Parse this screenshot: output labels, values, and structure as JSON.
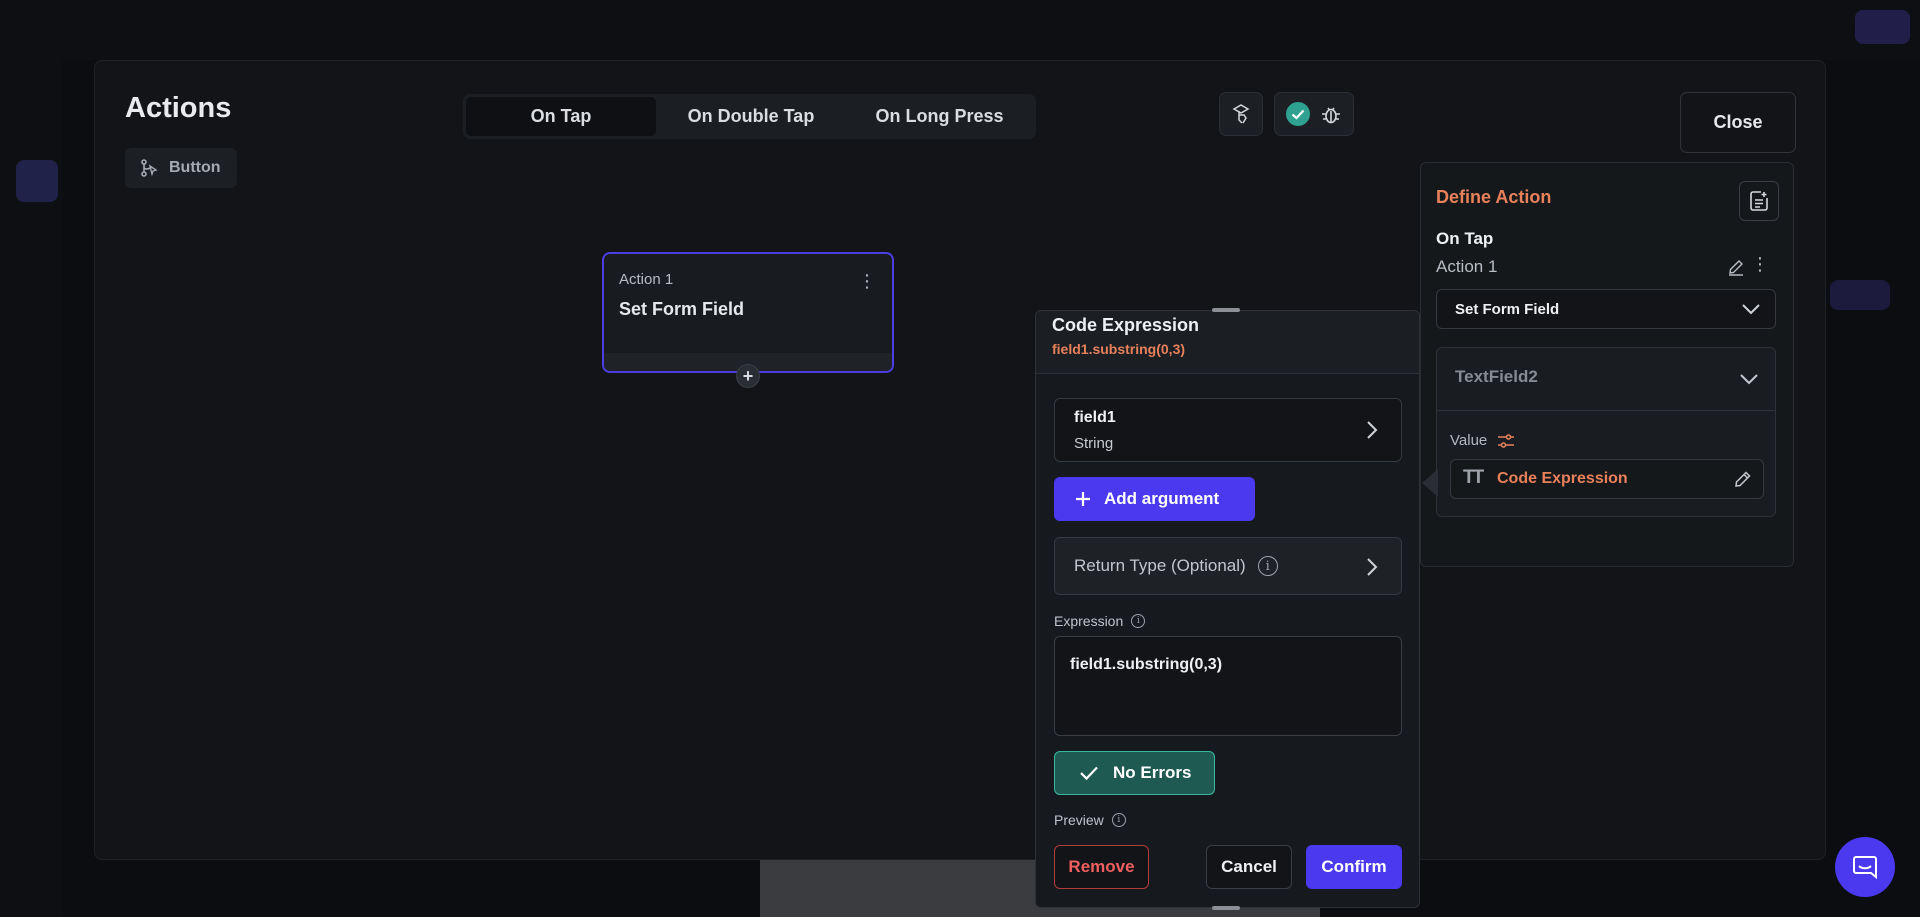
{
  "actions_editor": {
    "title": "Actions",
    "widget_chip_label": "Button",
    "tabs": [
      {
        "label": "On Tap",
        "active": true
      },
      {
        "label": "On Double Tap",
        "active": false
      },
      {
        "label": "On Long Press",
        "active": false
      }
    ],
    "close_label": "Close",
    "status_ok": true
  },
  "action_node": {
    "subtitle": "Action 1",
    "title": "Set Form Field",
    "add_symbol": "+"
  },
  "code_expression": {
    "title": "Code Expression",
    "subtitle": "field1.substring(0,3)",
    "argument": {
      "name": "field1",
      "type": "String"
    },
    "add_argument_label": "Add argument",
    "return_type_label": "Return Type (Optional)",
    "expression_label": "Expression",
    "expression_value": "field1.substring(0,3)",
    "no_errors_label": "No Errors",
    "preview_label": "Preview",
    "remove_label": "Remove",
    "cancel_label": "Cancel",
    "confirm_label": "Confirm"
  },
  "define_action": {
    "title": "Define Action",
    "trigger": "On Tap",
    "action_name": "Action 1",
    "selected_action": "Set Form Field",
    "field_name": "TextField2",
    "value_label": "Value",
    "value_text": "Code Expression"
  },
  "colors": {
    "accent": "#4b39ef",
    "orange": "#e8815a",
    "success": "#3bb79f",
    "danger": "#ef5f5f"
  }
}
